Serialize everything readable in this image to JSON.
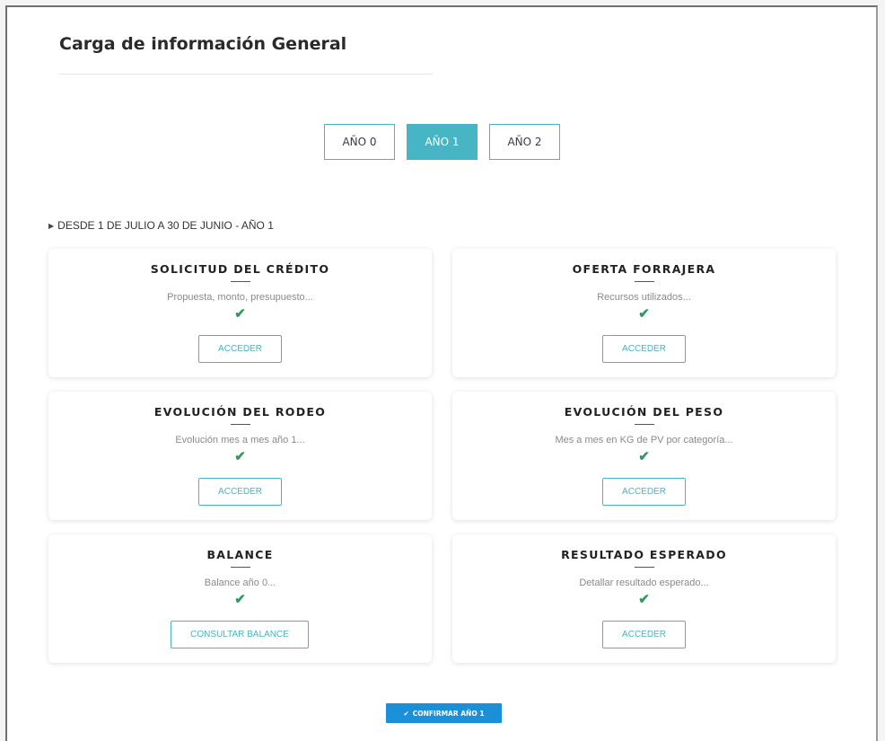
{
  "header": {
    "title": "Carga de información General"
  },
  "year_tabs": [
    {
      "label": "AÑO 0",
      "active": false
    },
    {
      "label": "AÑO 1",
      "active": true
    },
    {
      "label": "AÑO 2",
      "active": false
    }
  ],
  "period": {
    "label": "DESDE 1 DE JULIO A 30 DE JUNIO - AÑO 1"
  },
  "cards": [
    {
      "title": "SOLICITUD DEL CRÉDITO",
      "desc": "Propuesta, monto, presupuesto...",
      "check": "✔",
      "button": "ACCEDER"
    },
    {
      "title": "OFERTA FORRAJERA",
      "desc": "Recursos utilizados...",
      "check": "✔",
      "button": "ACCEDER"
    },
    {
      "title": "EVOLUCIÓN DEL RODEO",
      "desc": "Evolución mes a mes año 1...",
      "check": "✔",
      "button": "ACCEDER"
    },
    {
      "title": "EVOLUCIÓN DEL PESO",
      "desc": "Mes a mes en KG de PV por categoría...",
      "check": "✔",
      "button": "ACCEDER"
    },
    {
      "title": "BALANCE",
      "desc": "Balance año 0...",
      "check": "✔",
      "button": "CONSULTAR BALANCE"
    },
    {
      "title": "RESULTADO ESPERADO",
      "desc": "Detallar resultado esperado...",
      "check": "✔",
      "button": "ACCEDER"
    }
  ],
  "confirm": {
    "icon": "✔",
    "label": "CONFIRMAR AÑO 1"
  },
  "colors": {
    "accent": "#48b5c4",
    "confirm": "#1b8fd8",
    "check": "#2e9b5a"
  }
}
